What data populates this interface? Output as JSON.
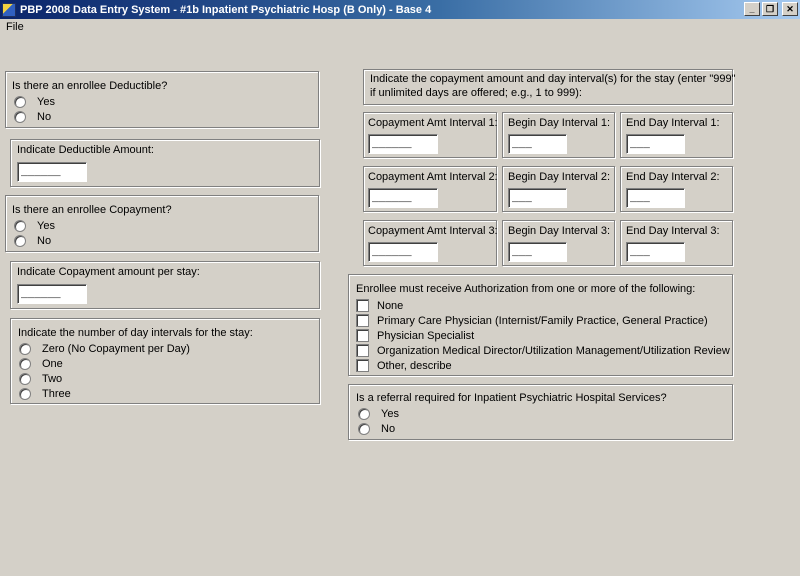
{
  "window": {
    "title": "PBP 2008 Data Entry System - #1b Inpatient Psychiatric Hosp (B Only) - Base 4",
    "minimize": "_",
    "restore": "❐",
    "close": "✕"
  },
  "menu": {
    "file_label": "File"
  },
  "deductible": {
    "question": "Is there an enrollee Deductible?",
    "options": [
      "Yes",
      "No"
    ]
  },
  "deductible_amount": {
    "label": "Indicate Deductible Amount:",
    "value": "______"
  },
  "copayment": {
    "question": "Is there an enrollee Copayment?",
    "options": [
      "Yes",
      "No"
    ]
  },
  "copayment_amount": {
    "label": "Indicate Copayment amount per stay:",
    "value": "______"
  },
  "day_intervals": {
    "label": "Indicate the number of day intervals for the stay:",
    "options": [
      "Zero (No Copayment per Day)",
      "One",
      "Two",
      "Three"
    ]
  },
  "interval_instructions": {
    "text_line1": "Indicate the copayment amount and day interval(s) for the stay (enter \"999\"",
    "text_line2": "if unlimited days are offered; e.g., 1 to 999):"
  },
  "intervals": [
    {
      "copay_label": "Copayment Amt Interval 1:",
      "copay_value": "______",
      "begin_label": "Begin Day Interval 1:",
      "begin_value": "___",
      "end_label": "End Day Interval 1:",
      "end_value": "___"
    },
    {
      "copay_label": "Copayment Amt Interval 2:",
      "copay_value": "______",
      "begin_label": "Begin Day Interval 2:",
      "begin_value": "___",
      "end_label": "End Day Interval 2:",
      "end_value": "___"
    },
    {
      "copay_label": "Copayment Amt Interval 3:",
      "copay_value": "______",
      "begin_label": "Begin Day Interval 3:",
      "begin_value": "___",
      "end_label": "End Day Interval 3:",
      "end_value": "___"
    }
  ],
  "authorization": {
    "label": "Enrollee must receive Authorization from one or more of the following:",
    "options": [
      "None",
      "Primary Care Physician (Internist/Family Practice, General Practice)",
      "Physician Specialist",
      "Organization Medical Director/Utilization Management/Utilization Review",
      "Other, describe"
    ]
  },
  "referral": {
    "question": "Is a referral required for Inpatient Psychiatric Hospital Services?",
    "options": [
      "Yes",
      "No"
    ]
  }
}
